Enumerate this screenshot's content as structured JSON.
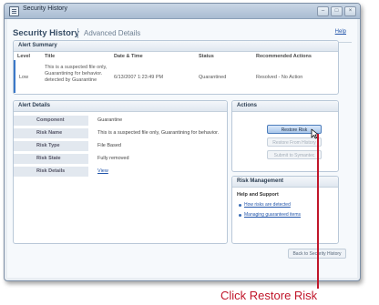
{
  "window": {
    "title": "Security History"
  },
  "header": {
    "title": "Security History",
    "subtitle": "Advanced Details",
    "help": "Help"
  },
  "summary": {
    "title": "Alert Summary",
    "columns": [
      "Level",
      "Title",
      "Date & Time",
      "Status",
      "Recommended Actions"
    ],
    "row": {
      "level": "Low",
      "title": "This is a suspected file only, Guarantining for behavior. detected by Guarantine",
      "datetime": "6/13/2007 1:23:49 PM",
      "status": "Quarantined",
      "action": "Resolved - No Action"
    }
  },
  "details": {
    "title": "Alert Details",
    "rows": [
      {
        "label": "Component",
        "value": "Guarantine"
      },
      {
        "label": "Risk Name",
        "value": "This is a suspected file only, Guarantining for behavior."
      },
      {
        "label": "Risk Type",
        "value": "File Based"
      },
      {
        "label": "Risk State",
        "value": "Fully removed"
      },
      {
        "label": "Risk Details",
        "value": "View"
      }
    ]
  },
  "actions": {
    "title": "Actions",
    "restore_risk": "Restore Risk",
    "restore_from_history": "Restore From History",
    "submit_to_symantec": "Submit to Symantec"
  },
  "risk_management": {
    "title": "Risk Management",
    "help_heading": "Help and Support",
    "links": [
      "How risks are detected",
      "Managing guaranteed items"
    ]
  },
  "footer": {
    "back": "Back to Security History"
  },
  "callout": {
    "text": "Click Restore Risk",
    "color": "#c0162a"
  }
}
